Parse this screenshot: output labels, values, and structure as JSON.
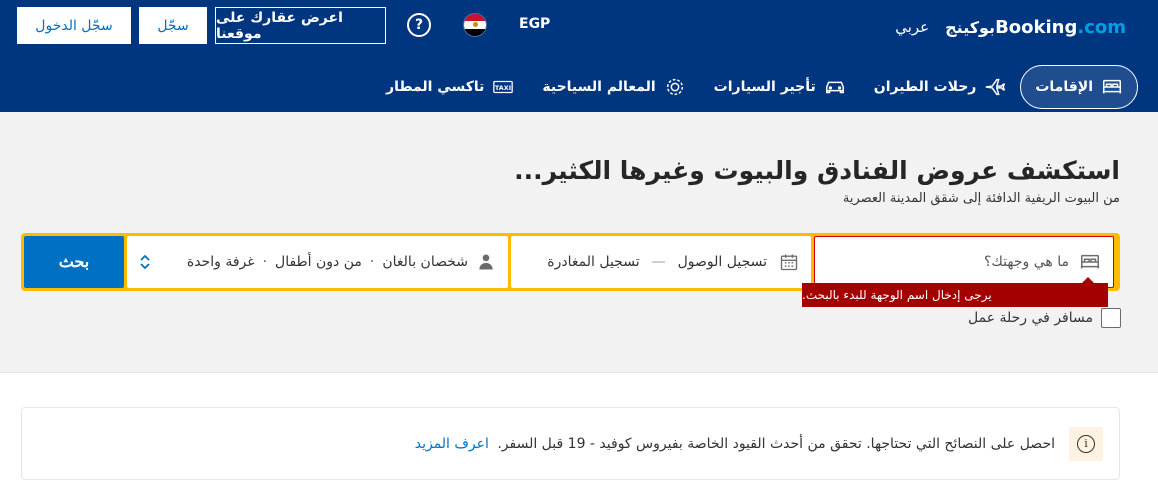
{
  "header": {
    "logo": {
      "main": "Booking",
      "suffix": ".com",
      "arabic": "بوكينج",
      "language": "عربي"
    },
    "currency": "EGP",
    "help_symbol": "?",
    "list_property_label": "اعرض عقارك على موقعنا",
    "register_label": "سجّل",
    "signin_label": "سجّل الدخول",
    "flag": "egypt-flag-icon"
  },
  "nav": {
    "items": [
      {
        "label": "الإقامات",
        "icon": "bed-icon",
        "active": true
      },
      {
        "label": "رحلات الطيران",
        "icon": "airplane-icon",
        "active": false
      },
      {
        "label": "تأجير السيارات",
        "icon": "car-icon",
        "active": false
      },
      {
        "label": "المعالم السياحية",
        "icon": "attractions-icon",
        "active": false
      },
      {
        "label": "تاكسي المطار",
        "icon": "taxi-icon",
        "active": false
      }
    ]
  },
  "hero": {
    "title": "استكشف عروض الفنادق والبيوت وغيرها الكثير...",
    "subtitle": "من البيوت الريفية الدافئة إلى شقق المدينة العصرية"
  },
  "search": {
    "destination_placeholder": "ما هي وجهتك؟",
    "checkin_label": "تسجيل الوصول",
    "checkout_label": "تسجيل المغادرة",
    "dash": "—",
    "adults": "شخصان بالغان",
    "children": "من دون أطفال",
    "rooms": "غرفة واحدة",
    "dot": "·",
    "button_label": "بحث",
    "error_message": "يرجى إدخال اسم الوجهة للبدء بالبحث.",
    "business_label": "مسافر في رحلة عمل"
  },
  "notice": {
    "text": "احصل على النصائح التي تحتاجها. تحقق من أحدث القيود الخاصة بفيروس كوفيد - 19 قبل السفر.",
    "link": "اعرف المزيد",
    "icon_symbol": "i"
  },
  "colors": {
    "header_bg": "#003580",
    "accent_blue": "#0071c2",
    "search_border": "#febb02",
    "error_bg": "#a30000"
  }
}
